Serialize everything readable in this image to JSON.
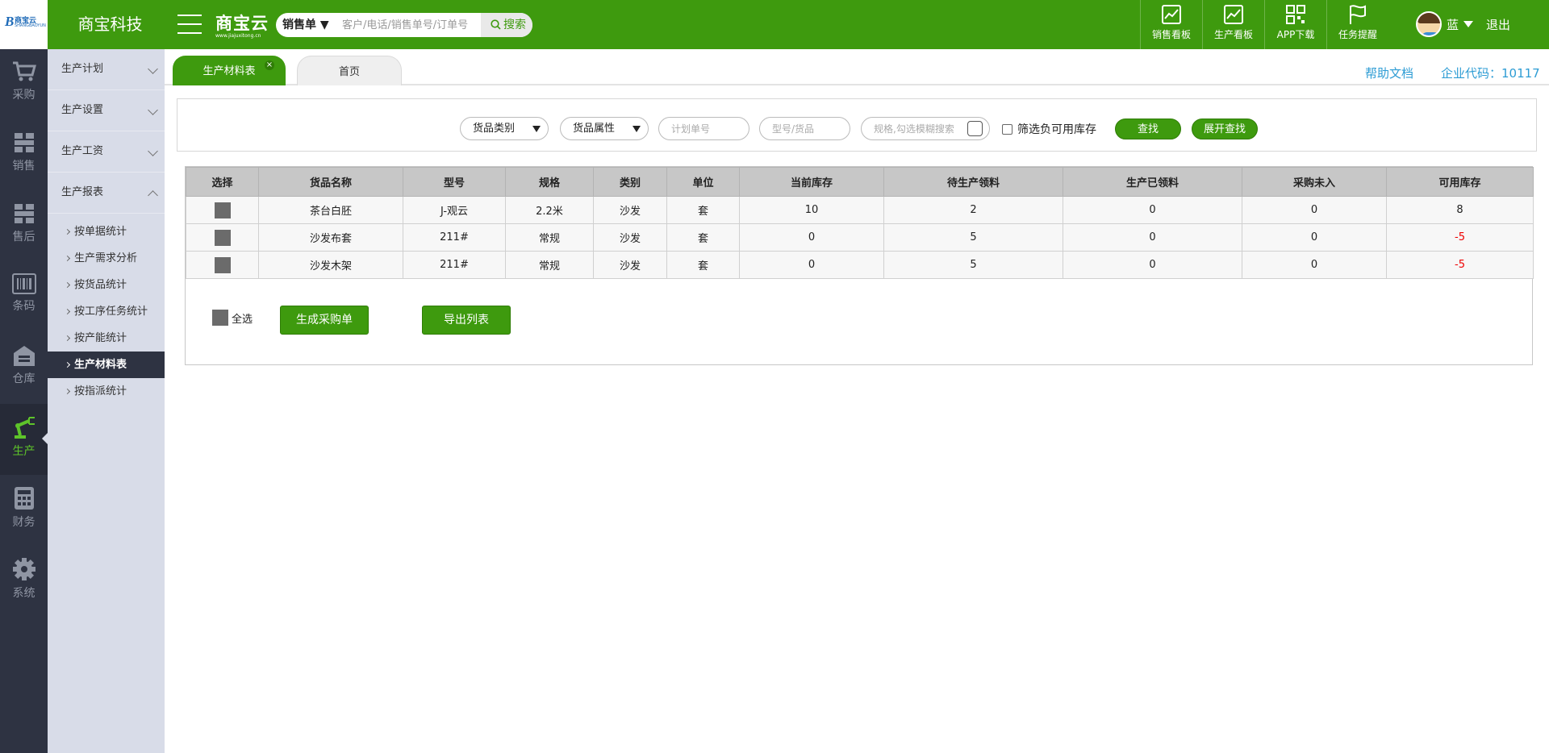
{
  "brand": {
    "logo_mark": "B",
    "logo_text": "商宝云",
    "logo_sub": "SHANGBAOYUN",
    "company": "商宝科技",
    "cloud_name": "商宝云",
    "cloud_url": "www.jiajuxitong.cn"
  },
  "search": {
    "type": "销售单",
    "placeholder": "客户/电话/销售单号/订单号",
    "button": "搜索"
  },
  "topnav": [
    {
      "label": "销售看板",
      "icon": "chart-icon"
    },
    {
      "label": "生产看板",
      "icon": "chart-icon"
    },
    {
      "label": "APP下载",
      "icon": "qrcode-icon"
    },
    {
      "label": "任务提醒",
      "icon": "flag-icon"
    }
  ],
  "user": {
    "name": "蓝",
    "logout": "退出"
  },
  "rail": [
    {
      "label": "采购",
      "icon": "cart-icon"
    },
    {
      "label": "销售",
      "icon": "grid-icon"
    },
    {
      "label": "售后",
      "icon": "grid-icon"
    },
    {
      "label": "条码",
      "icon": "barcode-icon"
    },
    {
      "label": "仓库",
      "icon": "warehouse-icon"
    },
    {
      "label": "生产",
      "icon": "robot-arm-icon"
    },
    {
      "label": "财务",
      "icon": "calculator-icon"
    },
    {
      "label": "系统",
      "icon": "gear-icon"
    }
  ],
  "submenu": {
    "groups": [
      "生产计划",
      "生产设置",
      "生产工资",
      "生产报表"
    ],
    "items": [
      "按单据统计",
      "生产需求分析",
      "按货品统计",
      "按工序任务统计",
      "按产能统计",
      "生产材料表",
      "按指派统计"
    ],
    "active_item": "生产材料表"
  },
  "tabs": {
    "active": "生产材料表",
    "close": "×",
    "home": "首页"
  },
  "help": "帮助文档",
  "corp_code": "企业代码：10117",
  "filters": {
    "category": "货品类别",
    "attribute": "货品属性",
    "plan_no_placeholder": "计划单号",
    "model_placeholder": "型号/货品",
    "spec_placeholder": "规格,勾选模糊搜索",
    "negative_stock": "筛选负可用库存",
    "search_button": "查找",
    "expand_button": "展开查找"
  },
  "table": {
    "headers": [
      "选择",
      "货品名称",
      "型号",
      "规格",
      "类别",
      "单位",
      "当前库存",
      "待生产领料",
      "生产已领料",
      "采购未入",
      "可用库存"
    ],
    "rows": [
      {
        "name": "茶台白胚",
        "model": "J-观云",
        "spec": "2.2米",
        "category": "沙发",
        "unit": "套",
        "stock": "10",
        "pending": "2",
        "picked": "0",
        "purchase_pending": "0",
        "available": "8"
      },
      {
        "name": "沙发布套",
        "model": "211#",
        "spec": "常规",
        "category": "沙发",
        "unit": "套",
        "stock": "0",
        "pending": "5",
        "picked": "0",
        "purchase_pending": "0",
        "available": "-5"
      },
      {
        "name": "沙发木架",
        "model": "211#",
        "spec": "常规",
        "category": "沙发",
        "unit": "套",
        "stock": "0",
        "pending": "5",
        "picked": "0",
        "purchase_pending": "0",
        "available": "-5"
      }
    ]
  },
  "actions": {
    "select_all": "全选",
    "create_po": "生成采购单",
    "export": "导出列表"
  },
  "colors": {
    "brand_green": "#3e9a0e",
    "rail_bg": "#2e3342",
    "submenu_bg": "#d8dce8",
    "link_blue": "#2d9cd4",
    "negative_red": "#ee0000"
  }
}
